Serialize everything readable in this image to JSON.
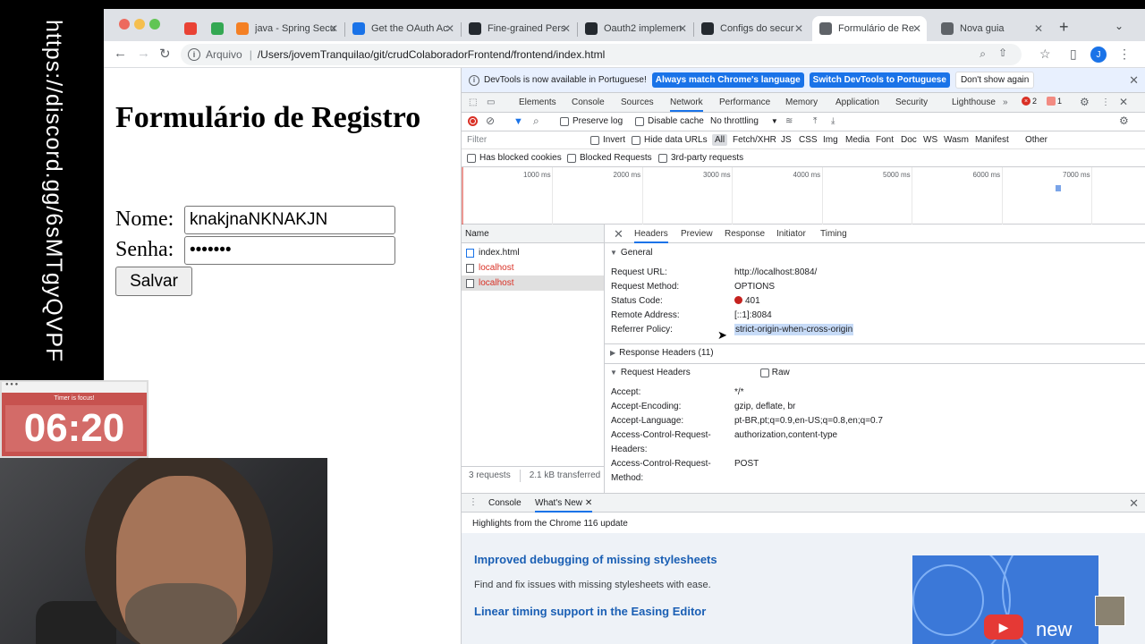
{
  "left_strip": {
    "vertical_text": "https://discord.gg/6sMTgyQVPF"
  },
  "browser": {
    "tabs": [
      {
        "label": "",
        "icon": "chrome-icon",
        "color": "#e94235"
      },
      {
        "label": "",
        "icon": "grid-icon",
        "color": "#34a853"
      },
      {
        "label": "java - Spring Secu",
        "icon": "stackoverflow-icon",
        "color": "#f48024"
      },
      {
        "label": "Get the OAuth Ac",
        "icon": "okta-icon",
        "color": "#1a73e8"
      },
      {
        "label": "Fine-grained Pers",
        "icon": "github-icon",
        "color": "#24292f"
      },
      {
        "label": "Oauth2 implemen",
        "icon": "github-icon",
        "color": "#24292f"
      },
      {
        "label": "Configs do secur",
        "icon": "github-icon",
        "color": "#24292f"
      },
      {
        "label": "Formulário de Re",
        "icon": "globe-icon",
        "color": "#5f6368",
        "active": true
      },
      {
        "label": "Nova guia",
        "icon": "globe-icon",
        "color": "#5f6368"
      }
    ],
    "omnibox": {
      "scheme_label": "Arquivo",
      "path": "/Users/jovemTranquilao/git/crudColaboradorFrontend/frontend/index.html"
    },
    "avatar_letter": "J"
  },
  "page": {
    "title": "Formulário de Registro",
    "nome_label": "Nome:",
    "nome_value": "knakjnaNKNAKJN",
    "senha_label": "Senha:",
    "senha_value": "•••••••",
    "save_label": "Salvar"
  },
  "devtools": {
    "infobar": {
      "message": "DevTools is now available in Portuguese!",
      "btn_match": "Always match Chrome's language",
      "btn_switch": "Switch DevTools to Portuguese",
      "btn_dismiss": "Don't show again"
    },
    "tabs": [
      "Elements",
      "Console",
      "Sources",
      "Network",
      "Performance",
      "Memory",
      "Application",
      "Security",
      "Lighthouse"
    ],
    "errors_count": "2",
    "issues_count": "1",
    "network_toolbar": {
      "preserve_log": "Preserve log",
      "disable_cache": "Disable cache",
      "throttling": "No throttling"
    },
    "filter": {
      "placeholder": "Filter",
      "invert": "Invert",
      "hide_data_urls": "Hide data URLs",
      "types": [
        "All",
        "Fetch/XHR",
        "JS",
        "CSS",
        "Img",
        "Media",
        "Font",
        "Doc",
        "WS",
        "Wasm",
        "Manifest",
        "Other"
      ]
    },
    "blocked": {
      "cookies": "Has blocked cookies",
      "requests": "Blocked Requests",
      "third_party": "3rd-party requests"
    },
    "overview_ticks": [
      "1000 ms",
      "2000 ms",
      "3000 ms",
      "4000 ms",
      "5000 ms",
      "6000 ms",
      "7000 ms"
    ],
    "request_list": {
      "header": "Name",
      "rows": [
        {
          "name": "index.html",
          "error": false
        },
        {
          "name": "localhost",
          "error": true
        },
        {
          "name": "localhost",
          "error": true,
          "selected": true
        }
      ],
      "footer_requests": "3 requests",
      "footer_transferred": "2.1 kB transferred"
    },
    "detail_tabs": [
      "Headers",
      "Preview",
      "Response",
      "Initiator",
      "Timing"
    ],
    "general": {
      "title": "General",
      "rows": [
        {
          "k": "Request URL:",
          "v": "http://localhost:8084/"
        },
        {
          "k": "Request Method:",
          "v": "OPTIONS"
        },
        {
          "k": "Status Code:",
          "v": "401"
        },
        {
          "k": "Remote Address:",
          "v": "[::1]:8084"
        },
        {
          "k": "Referrer Policy:",
          "v": "strict-origin-when-cross-origin"
        }
      ]
    },
    "response_headers_title": "Response Headers (11)",
    "request_headers": {
      "title": "Request Headers",
      "raw_label": "Raw",
      "rows": [
        {
          "k": "Accept:",
          "v": "*/*"
        },
        {
          "k": "Accept-Encoding:",
          "v": "gzip, deflate, br"
        },
        {
          "k": "Accept-Language:",
          "v": "pt-BR,pt;q=0.9,en-US;q=0.8,en;q=0.7"
        },
        {
          "k1": "Access-Control-Request-",
          "k2": "Headers:",
          "v": "authorization,content-type"
        },
        {
          "k1": "Access-Control-Request-",
          "k2": "Method:",
          "v": "POST"
        }
      ]
    },
    "drawer": {
      "tab_console": "Console",
      "tab_whatsnew": "What's New",
      "highlights": "Highlights from the Chrome 116 update",
      "h1": "Improved debugging of missing stylesheets",
      "p1": "Find and fix issues with missing stylesheets with ease.",
      "h2": "Linear timing support in the Easing Editor",
      "img_label": "new"
    }
  },
  "timer": {
    "title": "Timer is focus!",
    "value": "06:20"
  }
}
